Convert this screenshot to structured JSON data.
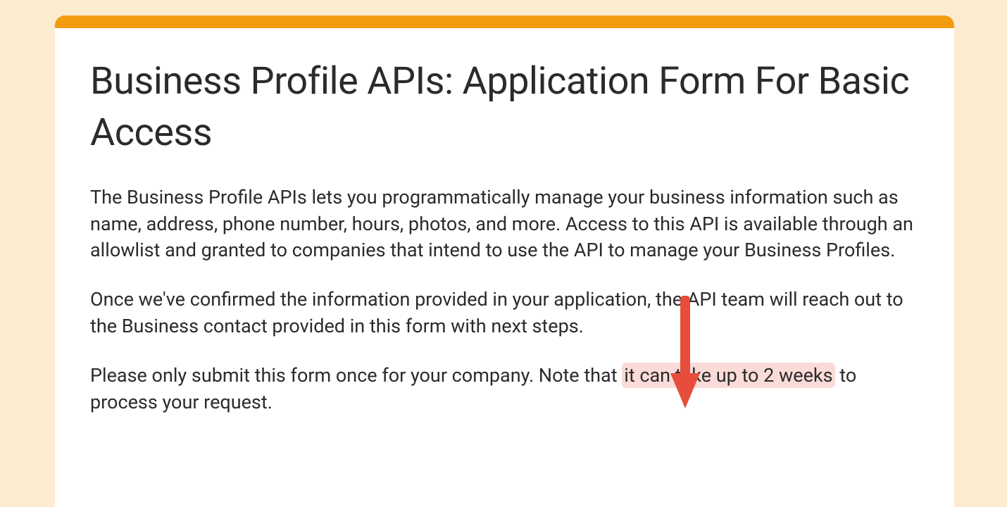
{
  "colors": {
    "accent": "#F39C12",
    "background": "#FDEBD0",
    "card": "#FFFFFF",
    "highlight_bg": "#FADBD8",
    "arrow": "#E74C3C",
    "text": "#2b2b2b"
  },
  "header": {
    "title": "Business Profile APIs: Application Form For Basic Access"
  },
  "body": {
    "p1": "The Business Profile APIs lets you programmatically manage your business information such as name, address, phone number, hours, photos, and more. Access to this API is available through an allowlist and granted to companies that intend to use the API to manage your Business Profiles.",
    "p2": "Once we've confirmed the information provided in your application, the API team will reach out to the Business contact provided in this form with next steps.",
    "p3_part1": "Please only submit this form once for your company. Note that ",
    "p3_highlight": "it can take up to 2 weeks",
    "p3_part2": " to process your request."
  }
}
